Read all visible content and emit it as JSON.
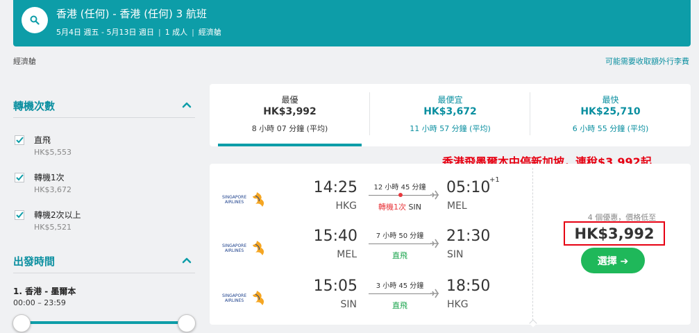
{
  "header": {
    "title": "香港 (任何) - 香港 (任何) 3 航班",
    "dates": "5月4日 週五 - 5月13日 週日",
    "passengers": "1 成人",
    "cabin": "經濟艙",
    "separator": "|",
    "search_icon": "search-icon",
    "background_color": "#0d9da8"
  },
  "subheader": {
    "cabin_label": "經濟艙",
    "baggage_link": "可能需要收取額外行李費"
  },
  "filters": {
    "stops": {
      "title": "轉機次數",
      "options": [
        {
          "label": "直飛",
          "price": "HK$5,553",
          "checked": true
        },
        {
          "label": "轉機1次",
          "price": "HK$3,672",
          "checked": true
        },
        {
          "label": "轉機2次以上",
          "price": "HK$5,521",
          "checked": true
        }
      ]
    },
    "departure_time": {
      "title": "出發時間",
      "route": "1. 香港 - 墨爾本",
      "range": "00:00 – 23:59"
    }
  },
  "sort_tabs": [
    {
      "name": "最優",
      "price": "HK$3,992",
      "duration": "8 小時 07 分鐘 (平均)",
      "active": true
    },
    {
      "name": "最便宜",
      "price": "HK$3,672",
      "duration": "11 小時 57 分鐘 (平均)",
      "active": false
    },
    {
      "name": "最快",
      "price": "HK$25,710",
      "duration": "6 小時 55 分鐘 (平均)",
      "active": false
    }
  ],
  "annotation": "香港飛墨爾本中停新加坡，連稅$3,992起",
  "result": {
    "legs": [
      {
        "airline": "SINGAPORE AIRLINES",
        "dep_time": "14:25",
        "dep_code": "HKG",
        "arr_time": "05:10",
        "arr_plus": "+1",
        "arr_code": "MEL",
        "duration": "12 小時 45 分鐘",
        "stops": "轉機1次",
        "via": "SIN"
      },
      {
        "airline": "SINGAPORE AIRLINES",
        "dep_time": "15:40",
        "dep_code": "MEL",
        "arr_time": "21:30",
        "arr_code": "SIN",
        "duration": "7 小時 50 分鐘",
        "stops": "直飛"
      },
      {
        "airline": "SINGAPORE AIRLINES",
        "dep_time": "15:05",
        "dep_code": "SIN",
        "arr_time": "18:50",
        "arr_code": "HKG",
        "duration": "3 小時 45 分鐘",
        "stops": "直飛"
      }
    ],
    "deals_text": "4 個優惠，價格低至",
    "price": "HK$3,992",
    "select_label": "選擇 ➔",
    "accent_green": "#1fb85a",
    "highlight_red": "#e60012"
  }
}
